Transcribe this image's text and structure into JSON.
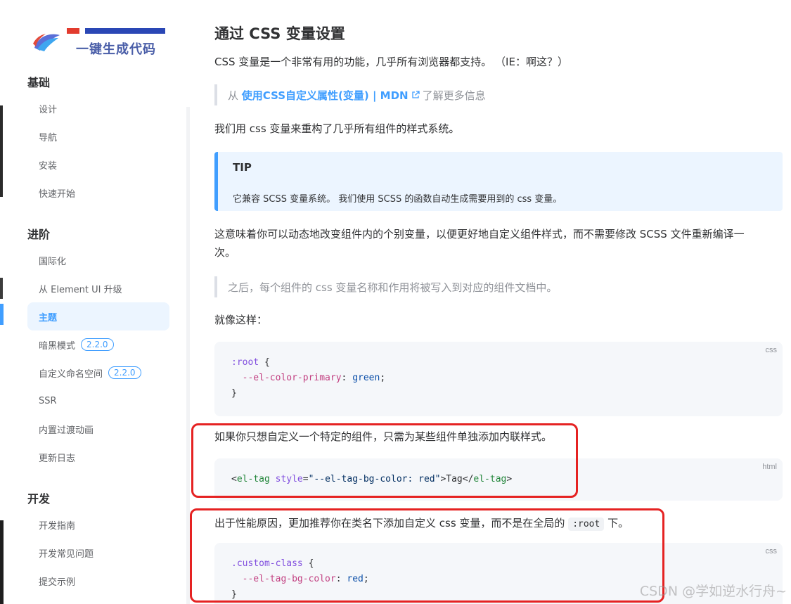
{
  "logo": {
    "slogan": "一键生成代码",
    "name": "logo"
  },
  "sidebar": {
    "groups": [
      {
        "title": "基础",
        "items": [
          "设计",
          "导航",
          "安装",
          "快速开始"
        ]
      },
      {
        "title": "进阶",
        "items": [
          "国际化",
          "从 Element UI 升级",
          "主题",
          "暗黑模式",
          "自定义命名空间",
          "SSR",
          "内置过渡动画",
          "更新日志"
        ]
      },
      {
        "title": "开发",
        "items": [
          "开发指南",
          "开发常见问题",
          "提交示例"
        ]
      }
    ],
    "active_item": "主题",
    "badges": {
      "dark_mode": "2.2.0",
      "namespace": "2.2.0"
    }
  },
  "content": {
    "heading": "通过 CSS 变量设置",
    "intro": "CSS 变量是一个非常有用的功能，几乎所有浏览器都支持。 （IE：啊这？）",
    "quote1": {
      "prefix": "从",
      "link": "使用CSS自定义属性(变量) | MDN",
      "suffix": "了解更多信息"
    },
    "p2": "我们用 css 变量来重构了几乎所有组件的样式系统。",
    "tip": {
      "title": "TIP",
      "text": "它兼容 SCSS 变量系统。 我们使用 SCSS 的函数自动生成需要用到的 css 变量。"
    },
    "p3_line1": "这意味着你可以动态地改变组件内的个别变量，以便更好地自定义组件样式，而不需要修改 SCSS 文件重新编译一",
    "p3_line2": "次。",
    "quote2": "之后，每个组件的 css 变量名称和作用将被写入到对应的组件文档中。",
    "p4": "就像这样：",
    "code1": {
      "lang": "css",
      "lines": [
        ":root {",
        "  --el-color-primary: green;",
        "}"
      ]
    },
    "p5": "如果你只想自定义一个特定的组件，只需为某些组件单独添加内联样式。",
    "code2": {
      "lang": "html",
      "line": "<el-tag style=\"--el-tag-bg-color: red\">Tag</el-tag>"
    },
    "p6_before": "出于性能原因，更加推荐你在类名下添加自定义 css 变量，而不是在全局的",
    "p6_code": ":root",
    "p6_after": "下。",
    "code3": {
      "lang": "css",
      "lines": [
        ".custom-class {",
        "  --el-tag-bg-color: red;",
        "}"
      ]
    }
  },
  "watermark": "CSDN @学如逆水行舟~"
}
